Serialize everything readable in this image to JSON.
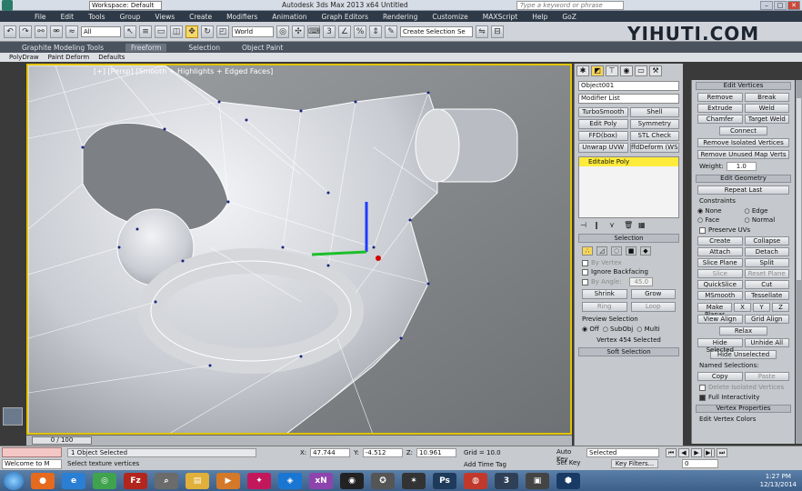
{
  "titlebar": {
    "workspace": "Workspace: Default",
    "title": "Autodesk 3ds Max  2013 x64      Untitled",
    "search_placeholder": "Type a keyword or phrase"
  },
  "menu": [
    "File",
    "Edit",
    "Tools",
    "Group",
    "Views",
    "Create",
    "Modifiers",
    "Animation",
    "Graph Editors",
    "Rendering",
    "Customize",
    "MAXScript",
    "Help",
    "GoZ"
  ],
  "toolbar": {
    "filter": "All",
    "coord_system": "World",
    "selection_set_placeholder": "Create Selection Se"
  },
  "watermark": "YIHUTI.COM",
  "ribbon": {
    "tabs": [
      "Graphite Modeling Tools",
      "Freeform",
      "Selection",
      "Object Paint"
    ],
    "active_tab": "Freeform",
    "subtabs": [
      "PolyDraw",
      "Paint Deform",
      "Defaults"
    ]
  },
  "viewport": {
    "label": "[+] [Persp] [Smooth + Highlights + Edged Faces]"
  },
  "command_panel": {
    "object_name": "Object001",
    "modifier_list": "Modifier List",
    "modifier_buttons": [
      "TurboSmooth",
      "Shell",
      "Edit Poly",
      "Symmetry",
      "FFD(box)",
      "STL Check",
      "Unwrap UVW",
      "ffdDeform (WS"
    ],
    "stack_item": "Editable Poly",
    "selection_rollout": "Selection",
    "by_vertex": "By Vertex",
    "ignore_backfacing": "Ignore Backfacing",
    "by_angle": "By Angle:",
    "by_angle_value": "45.0",
    "shrink": "Shrink",
    "grow": "Grow",
    "ring": "Ring",
    "loop": "Loop",
    "preview_selection": "Preview Selection",
    "preview_options": [
      "Off",
      "SubObj",
      "Multi"
    ],
    "status": "Vertex 454 Selected",
    "soft_selection": "Soft Selection"
  },
  "right_panel": {
    "edit_vertices": "Edit Vertices",
    "ev_buttons": [
      "Remove",
      "Break",
      "Extrude",
      "Weld",
      "Chamfer",
      "Target Weld"
    ],
    "connect": "Connect",
    "remove_isolated": "Remove Isolated Vertices",
    "remove_unused": "Remove Unused Map Verts",
    "weight_label": "Weight:",
    "weight_value": "1.0",
    "edit_geometry": "Edit Geometry",
    "repeat_last": "Repeat Last",
    "constraints": "Constraints",
    "constraint_options": [
      "None",
      "Edge",
      "Face",
      "Normal"
    ],
    "preserve_uvs": "Preserve UVs",
    "eg_buttons": [
      "Create",
      "Collapse",
      "Attach",
      "Detach",
      "Slice Plane",
      "Split",
      "Slice",
      "Reset Plane",
      "QuickSlice",
      "Cut"
    ],
    "msmooth": "MSmooth",
    "tessellate": "Tessellate",
    "make_planar": "Make Planar",
    "xyz": [
      "X",
      "Y",
      "Z"
    ],
    "view_align": "View Align",
    "grid_align": "Grid Align",
    "relax": "Relax",
    "hide_selected": "Hide Selected",
    "unhide_all": "Unhide All",
    "hide_unselected": "Hide Unselected",
    "named_selections": "Named Selections:",
    "copy": "Copy",
    "paste": "Paste",
    "delete_isolated": "Delete Isolated Vertices",
    "full_interactivity": "Full Interactivity",
    "vertex_properties": "Vertex Properties",
    "edit_vertex_colors": "Edit Vertex Colors"
  },
  "timeline": {
    "frame": "0 / 100"
  },
  "status": {
    "welcome": "Welcome to M",
    "objects_selected": "1 Object Selected",
    "prompt": "Select texture vertices",
    "x": "47.744",
    "y": "-4.512",
    "z": "10.961",
    "grid": "Grid = 10.0",
    "add_time_tag": "Add Time Tag",
    "auto_key": "Auto Key",
    "set_key": "Set Key",
    "key_mode": "Selected",
    "key_filters": "Key Filters...",
    "frame_field": "0"
  },
  "taskbar": {
    "time": "1:27 PM",
    "date": "12/13/2014"
  }
}
